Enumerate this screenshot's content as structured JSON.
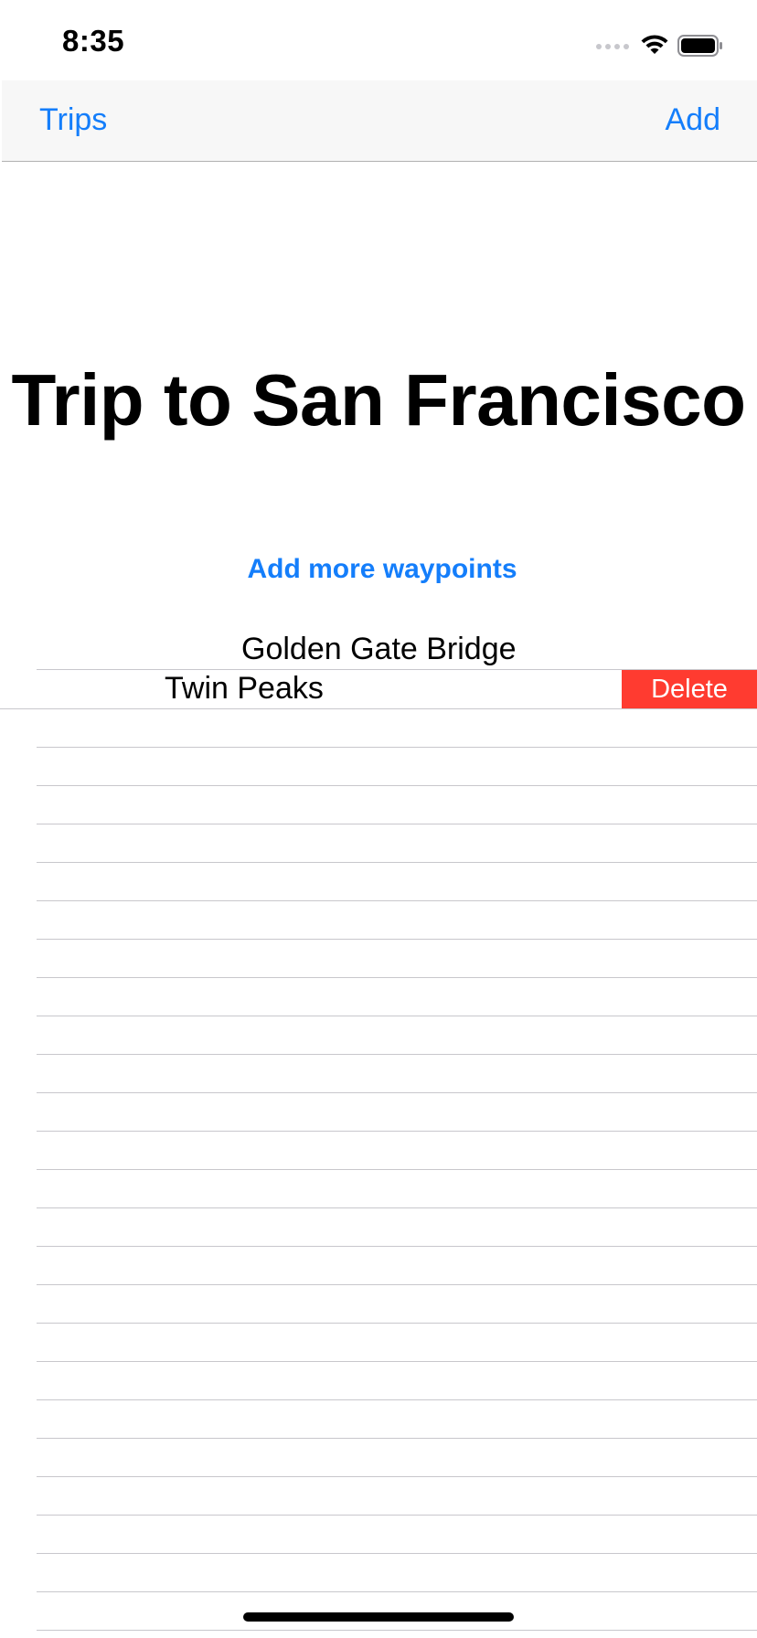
{
  "status_bar": {
    "time": "8:35",
    "icons": [
      "cellular-signal-icon",
      "wifi-icon",
      "battery-icon"
    ]
  },
  "nav": {
    "back_label": "Trips",
    "add_label": "Add"
  },
  "trip": {
    "title": "Trip to San Francisco",
    "add_waypoints_label": "Add more waypoints"
  },
  "waypoints": [
    {
      "name": "Golden Gate Bridge"
    },
    {
      "name": "Twin Peaks"
    }
  ],
  "swipe_action": {
    "label": "Delete",
    "color": "#ff3b30"
  },
  "colors": {
    "accent": "#147efb",
    "destructive": "#ff3b30"
  }
}
